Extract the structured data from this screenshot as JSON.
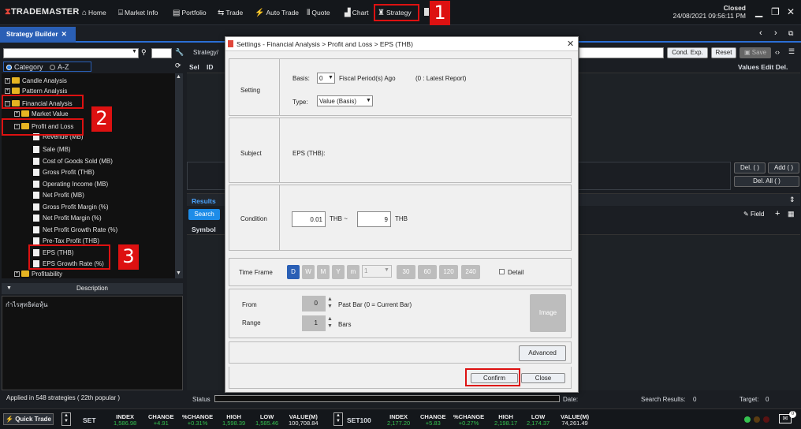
{
  "app": {
    "name": "TRADEMASTER"
  },
  "nav": {
    "home": "Home",
    "market_info": "Market Info",
    "portfolio": "Portfolio",
    "trade": "Trade",
    "auto_trade": "Auto Trade",
    "quote": "Quote",
    "chart": "Chart",
    "strategy": "Strategy"
  },
  "status": {
    "market": "Closed",
    "datetime": "24/08/2021 09:56:11 PM"
  },
  "tab": {
    "label": "Strategy Builder"
  },
  "left": {
    "mode_category": "Category",
    "mode_az": "A-Z",
    "tree": [
      {
        "label": "Candle Analysis"
      },
      {
        "label": "Pattern Analysis"
      },
      {
        "label": "Financial Analysis"
      },
      {
        "label": "Market Value"
      },
      {
        "label": "Profit and Loss"
      },
      {
        "label": "Revenue (MB)"
      },
      {
        "label": "Sale (MB)"
      },
      {
        "label": "Cost of Goods Sold (MB)"
      },
      {
        "label": "Gross Profit (THB)"
      },
      {
        "label": "Operating Income (MB)"
      },
      {
        "label": "Net Profit (MB)"
      },
      {
        "label": "Gross Profit Margin (%)"
      },
      {
        "label": "Net Profit Margin (%)"
      },
      {
        "label": "Net Profit Growth Rate (%)"
      },
      {
        "label": "Pre-Tax Profit (THB)"
      },
      {
        "label": "EPS (THB)"
      },
      {
        "label": "EPS Growth Rate (%)"
      },
      {
        "label": "Profitability"
      }
    ],
    "description_header": "Description",
    "description_text": "กำไรสุทธิต่อหุ้น",
    "applied": "Applied in 548 strategies ( 22th popular )"
  },
  "callouts": {
    "one": "1",
    "two": "2",
    "three": "3"
  },
  "right": {
    "strategy_label": "Strategy/",
    "cond_exp": "Cond. Exp.",
    "reset": "Reset",
    "save": "Save",
    "col_sel": "Sel",
    "col_id": "ID",
    "values_edit_del": "Values Edit  Del.",
    "del_one": "Del. ( )",
    "add_one": "Add ( )",
    "del_all": "Del. All ( )",
    "results": "Results",
    "search": "Search",
    "symbol": "Symbol",
    "field": "Field",
    "status_label": "Status",
    "date_label": "Date:",
    "search_results": "Search Results:",
    "search_results_val": "0",
    "target": "Target:",
    "target_val": "0"
  },
  "dialog": {
    "title": "Settings - Financial Analysis > Profit and Loss > EPS (THB)",
    "setting_label": "Setting",
    "basis_label": "Basis:",
    "basis_value": "0",
    "fiscal_text": "Fiscal Period(s) Ago",
    "latest_text": "(0 : Latest Report)",
    "type_label": "Type:",
    "type_value": "Value (Basis)",
    "subject_label": "Subject",
    "subject_value": "EPS (THB):",
    "condition_label": "Condition",
    "cond_from": "0.01",
    "cond_mid": "THB ~",
    "cond_to": "9",
    "cond_unit": "THB",
    "timeframe_label": "Time Frame",
    "tf": [
      "D",
      "W",
      "M",
      "Y",
      "m"
    ],
    "tf_select": "1",
    "tf_nums": [
      "30",
      "60",
      "120",
      "240"
    ],
    "detail": "Detail",
    "from_label": "From",
    "from_value": "0",
    "past_bar": "Past Bar (0 = Current Bar)",
    "range_label": "Range",
    "range_value": "1",
    "bars": "Bars",
    "image": "Image",
    "advanced": "Advanced",
    "confirm": "Confirm",
    "close": "Close"
  },
  "ticker": {
    "quick_trade": "Quick Trade",
    "set": {
      "name": "SET",
      "index": "1,586.98",
      "change": "+4.91",
      "pchange": "+0.31%",
      "high": "1,598.39",
      "low": "1,585.46",
      "value": "100,708.84"
    },
    "set100": {
      "name": "SET100",
      "index": "2,177.20",
      "change": "+5.83",
      "pchange": "+0.27%",
      "high": "2,198.17",
      "low": "2,174.37",
      "value": "74,261.49"
    },
    "h_index": "INDEX",
    "h_change": "CHANGE",
    "h_pchange": "%CHANGE",
    "h_high": "HIGH",
    "h_low": "LOW",
    "h_value": "VALUE(M)",
    "mail_count": "0"
  },
  "colors": {
    "accent": "#2a5fb5",
    "highlight": "#d11111",
    "up": "#35c24f"
  }
}
